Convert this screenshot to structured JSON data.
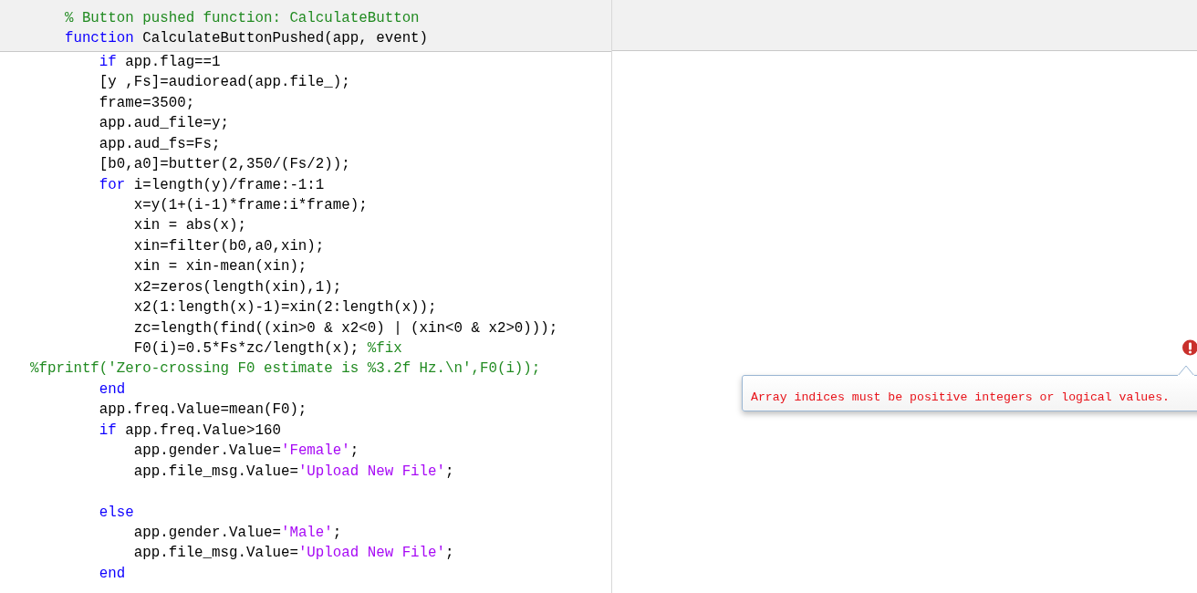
{
  "editor": {
    "header_lines": [
      {
        "kind": "code",
        "tokens": [
          {
            "kind": "comment",
            "text": "    % Button pushed function: CalculateButton"
          }
        ]
      },
      {
        "kind": "code",
        "tokens": [
          {
            "kind": "keyword",
            "text": "    function"
          },
          {
            "kind": "plain",
            "text": " CalculateButtonPushed(app, event)"
          }
        ]
      }
    ],
    "body_lines": [
      {
        "kind": "code",
        "tokens": [
          {
            "kind": "keyword",
            "text": "        if"
          },
          {
            "kind": "plain",
            "text": " app.flag==1"
          }
        ]
      },
      {
        "kind": "code",
        "tokens": [
          {
            "kind": "plain",
            "text": "        [y ,Fs]=audioread(app.file_);"
          }
        ]
      },
      {
        "kind": "code",
        "tokens": [
          {
            "kind": "plain",
            "text": "        frame=3500;"
          }
        ]
      },
      {
        "kind": "code",
        "tokens": [
          {
            "kind": "plain",
            "text": "        app.aud_file=y;"
          }
        ]
      },
      {
        "kind": "code",
        "tokens": [
          {
            "kind": "plain",
            "text": "        app.aud_fs=Fs;"
          }
        ]
      },
      {
        "kind": "code",
        "tokens": [
          {
            "kind": "plain",
            "text": "        [b0,a0]=butter(2,350/(Fs/2));"
          }
        ]
      },
      {
        "kind": "code",
        "tokens": [
          {
            "kind": "keyword",
            "text": "        for"
          },
          {
            "kind": "plain",
            "text": " i=length(y)/frame:-1:1"
          }
        ]
      },
      {
        "kind": "code",
        "tokens": [
          {
            "kind": "plain",
            "text": "            x=y(1+(i-1)*frame:i*frame);"
          }
        ]
      },
      {
        "kind": "code",
        "tokens": [
          {
            "kind": "plain",
            "text": "            xin = abs(x);"
          }
        ]
      },
      {
        "kind": "code",
        "tokens": [
          {
            "kind": "plain",
            "text": "            xin=filter(b0,a0,xin);"
          }
        ]
      },
      {
        "kind": "code",
        "tokens": [
          {
            "kind": "plain",
            "text": "            xin = xin-mean(xin);"
          }
        ]
      },
      {
        "kind": "code",
        "tokens": [
          {
            "kind": "plain",
            "text": "            x2=zeros(length(xin),1);"
          }
        ]
      },
      {
        "kind": "code",
        "tokens": [
          {
            "kind": "plain",
            "text": "            x2(1:length(x)-1)=xin(2:length(x));"
          }
        ]
      },
      {
        "kind": "code",
        "tokens": [
          {
            "kind": "plain",
            "text": "            zc=length(find((xin>0 & x2<0) | (xin<0 & x2>0)));"
          }
        ]
      },
      {
        "kind": "code",
        "tokens": [
          {
            "kind": "plain",
            "text": "            F0(i)=0.5*Fs*zc/length(x); "
          },
          {
            "kind": "comment",
            "text": "%fix"
          }
        ]
      },
      {
        "kind": "code",
        "tokens": [
          {
            "kind": "comment",
            "text": "%fprintf('Zero-crossing F0 estimate is %3.2f Hz.\\n',F0(i));"
          }
        ]
      },
      {
        "kind": "code",
        "tokens": [
          {
            "kind": "keyword",
            "text": "        end"
          }
        ]
      },
      {
        "kind": "code",
        "tokens": [
          {
            "kind": "plain",
            "text": "        app.freq.Value=mean(F0);"
          }
        ]
      },
      {
        "kind": "code",
        "tokens": [
          {
            "kind": "keyword",
            "text": "        if"
          },
          {
            "kind": "plain",
            "text": " app.freq.Value>160"
          }
        ]
      },
      {
        "kind": "code",
        "tokens": [
          {
            "kind": "plain",
            "text": "            app.gender.Value="
          },
          {
            "kind": "string",
            "text": "'Female'"
          },
          {
            "kind": "plain",
            "text": ";"
          }
        ]
      },
      {
        "kind": "code",
        "tokens": [
          {
            "kind": "plain",
            "text": "            app.file_msg.Value="
          },
          {
            "kind": "string",
            "text": "'Upload New File'"
          },
          {
            "kind": "plain",
            "text": ";"
          }
        ]
      },
      {
        "kind": "blank"
      },
      {
        "kind": "code",
        "tokens": [
          {
            "kind": "keyword",
            "text": "        else"
          }
        ]
      },
      {
        "kind": "code",
        "tokens": [
          {
            "kind": "plain",
            "text": "            app.gender.Value="
          },
          {
            "kind": "string",
            "text": "'Male'"
          },
          {
            "kind": "plain",
            "text": ";"
          }
        ]
      },
      {
        "kind": "code",
        "tokens": [
          {
            "kind": "plain",
            "text": "            app.file_msg.Value="
          },
          {
            "kind": "string",
            "text": "'Upload New File'"
          },
          {
            "kind": "plain",
            "text": ";"
          }
        ]
      },
      {
        "kind": "code",
        "tokens": [
          {
            "kind": "keyword",
            "text": "        end"
          }
        ]
      }
    ]
  },
  "error_tooltip": {
    "message": "Array indices must be positive integers or logical values."
  }
}
